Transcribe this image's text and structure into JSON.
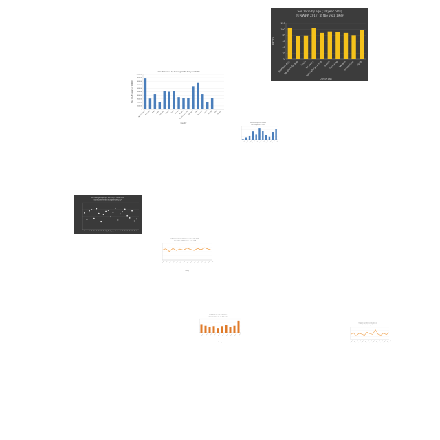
{
  "chart_data": [
    {
      "type": "bar",
      "title": "Sex ratio by age (70 year olds) (UNWPP, 2017) in the year 1989",
      "xlabel": "COUNTRY",
      "ylabel": "RATIO",
      "ylim": [
        0,
        120
      ],
      "yticks": [
        "0",
        "20",
        "40",
        "60",
        "80",
        "100",
        "120"
      ],
      "categories": [
        "Southern Asia",
        "Southern Europe",
        "Spain",
        "Sri Lanka",
        "Sub-Saharan Africa",
        "Sudan",
        "Suriname",
        "Sweden",
        "Switzerland",
        "Syria"
      ],
      "values": [
        104,
        77,
        79,
        104,
        88,
        93,
        90,
        88,
        80,
        98
      ],
      "colors": {
        "background": "#3c3c3c",
        "bar": "#f5c21b",
        "text": "#dddddd"
      }
    },
    {
      "type": "bar",
      "title": "CO₂ Emissions by burning oil for the year 1989",
      "xlabel": "Country",
      "ylabel": "Total CO₂ Emissions (* 10000)",
      "ylim": [
        0,
        1000000
      ],
      "yticks": [
        "0",
        "100000",
        "200000",
        "300000",
        "400000",
        "500000",
        "600000",
        "700000",
        "800000",
        "900000",
        "1000000"
      ],
      "categories": [
        "New Caledonia",
        "Nicaragua",
        "Niger",
        "Nigeria",
        "North Korea",
        "Norway",
        "Oman",
        "Pakistan",
        "Panama",
        "Papua New Guinea",
        "Paraguay",
        "Peru",
        "Philippines",
        "Poland",
        "Portugal",
        "Qatar",
        "Romania"
      ],
      "values": [
        880000,
        310000,
        430000,
        200000,
        510000,
        500000,
        510000,
        350000,
        330000,
        330000,
        660000,
        770000,
        430000,
        210000,
        320000
      ],
      "colors": {
        "background": "#ffffff",
        "bar": "#4a7ebb",
        "text": "#444444"
      }
    },
    {
      "type": "bar",
      "title": "Business enterprise on research and development in 1989",
      "values": [
        2,
        6,
        12,
        28,
        18,
        40,
        30,
        16,
        10,
        26,
        36
      ],
      "ylim": [
        0,
        45
      ],
      "colors": {
        "background": "#ffffff",
        "bar": "#4a7ebb",
        "text": "#777777"
      }
    },
    {
      "type": "scatter",
      "title": "Percentage of people working in urban area during the month of September 2014",
      "xlabel": "Industrial Sector",
      "ylabel": "",
      "x": [
        1,
        2,
        3,
        4,
        5,
        6,
        7,
        8,
        9,
        10,
        11,
        12,
        13,
        14,
        15,
        16,
        17,
        18,
        19,
        20,
        21,
        22,
        23
      ],
      "y": [
        62,
        38,
        70,
        74,
        42,
        78,
        60,
        30,
        56,
        68,
        72,
        48,
        64,
        80,
        36,
        58,
        66,
        76,
        52,
        44,
        70,
        32,
        40
      ],
      "ylim": [
        0,
        100
      ],
      "colors": {
        "background": "#3a3a3a",
        "marker": "#e6e6e6",
        "text": "#cccccc"
      }
    },
    {
      "type": "line",
      "title": "Urban population (% living in cities with 2000 population (1000)) in the year 1749",
      "xlabel": "Country",
      "ylabel": "",
      "values": [
        60,
        68,
        52,
        70,
        58,
        66,
        60,
        72,
        64,
        58,
        70,
        62,
        74,
        66,
        60
      ],
      "ylim": [
        0,
        100
      ],
      "colors": {
        "background": "#ffffff",
        "line": "#f0a04b",
        "text": "#777777"
      }
    },
    {
      "type": "bar",
      "title": "Gro-population (UN) Population Projections 2036 for the year 1923",
      "xlabel": "Country",
      "values": [
        44,
        36,
        30,
        34,
        24,
        34,
        40,
        30,
        36,
        60
      ],
      "ylim": [
        0,
        70
      ],
      "colors": {
        "background": "#ffffff",
        "bar": "#e07b2a",
        "text": "#777777"
      }
    },
    {
      "type": "line",
      "title": "Ex-public expenditure on education as a share of total expenditure",
      "values": [
        40,
        55,
        30,
        50,
        45,
        35,
        60,
        48,
        42,
        80,
        44,
        36,
        52,
        40,
        56
      ],
      "ylim": [
        0,
        100
      ],
      "colors": {
        "background": "#ffffff",
        "line": "#f0a04b",
        "text": "#777777"
      }
    }
  ]
}
